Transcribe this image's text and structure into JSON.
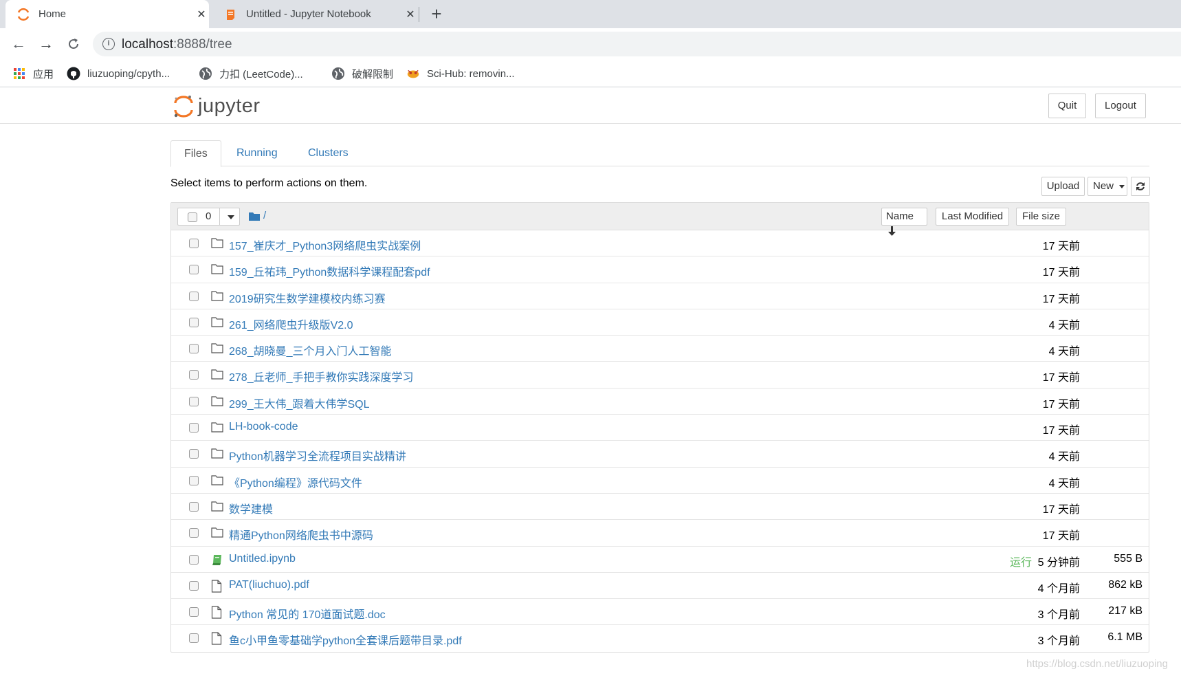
{
  "browser": {
    "tabs": [
      {
        "title": "Home",
        "active": true,
        "favicon": "jupyter-logo"
      },
      {
        "title": "Untitled - Jupyter Notebook",
        "active": false,
        "favicon": "notebook-icon"
      }
    ],
    "new_tab_symbol": "+",
    "address": {
      "host": "localhost",
      "rest": ":8888/tree"
    },
    "bookmarks": [
      {
        "label": "应用",
        "icon": "apps-grid-icon"
      },
      {
        "label": "liuzuoping/cpyth...",
        "icon": "github-icon"
      },
      {
        "label": "力扣 (LeetCode)...",
        "icon": "globe-icon"
      },
      {
        "label": "破解限制",
        "icon": "globe-icon"
      },
      {
        "label": "Sci-Hub: removin...",
        "icon": "scihub-icon"
      }
    ]
  },
  "header": {
    "logo_text": "jupyter",
    "quit_label": "Quit",
    "logout_label": "Logout"
  },
  "tabs": [
    {
      "label": "Files",
      "active": true
    },
    {
      "label": "Running",
      "active": false
    },
    {
      "label": "Clusters",
      "active": false
    }
  ],
  "hint_text": "Select items to perform actions on them.",
  "actions": {
    "upload_label": "Upload",
    "new_label": "New",
    "refresh_icon": "refresh-icon"
  },
  "list_header": {
    "selected_count": "0",
    "breadcrumb": "/",
    "sort_name_label": "Name",
    "sort_modified_label": "Last Modified",
    "sort_size_label": "File size"
  },
  "files": [
    {
      "type": "folder",
      "name": "157_崔庆才_Python3网络爬虫实战案例",
      "status": "",
      "modified": "17 天前",
      "size": ""
    },
    {
      "type": "folder",
      "name": "159_丘祐玮_Python数据科学课程配套pdf",
      "status": "",
      "modified": "17 天前",
      "size": ""
    },
    {
      "type": "folder",
      "name": "2019研究生数学建模校内练习赛",
      "status": "",
      "modified": "17 天前",
      "size": ""
    },
    {
      "type": "folder",
      "name": "261_网络爬虫升级版V2.0",
      "status": "",
      "modified": "4 天前",
      "size": ""
    },
    {
      "type": "folder",
      "name": "268_胡晓曼_三个月入门人工智能",
      "status": "",
      "modified": "4 天前",
      "size": ""
    },
    {
      "type": "folder",
      "name": "278_丘老师_手把手教你实践深度学习",
      "status": "",
      "modified": "17 天前",
      "size": ""
    },
    {
      "type": "folder",
      "name": "299_王大伟_跟着大伟学SQL",
      "status": "",
      "modified": "17 天前",
      "size": ""
    },
    {
      "type": "folder",
      "name": "LH-book-code",
      "status": "",
      "modified": "17 天前",
      "size": ""
    },
    {
      "type": "folder",
      "name": "Python机器学习全流程项目实战精讲",
      "status": "",
      "modified": "4 天前",
      "size": ""
    },
    {
      "type": "folder",
      "name": "《Python编程》源代码文件",
      "status": "",
      "modified": "4 天前",
      "size": ""
    },
    {
      "type": "folder",
      "name": "数学建模",
      "status": "",
      "modified": "17 天前",
      "size": ""
    },
    {
      "type": "folder",
      "name": "精通Python网络爬虫书中源码",
      "status": "",
      "modified": "17 天前",
      "size": ""
    },
    {
      "type": "notebook",
      "name": "Untitled.ipynb",
      "status": "运行",
      "modified": "5 分钟前",
      "size": "555 B"
    },
    {
      "type": "file",
      "name": "PAT(liuchuo).pdf",
      "status": "",
      "modified": "4 个月前",
      "size": "862 kB"
    },
    {
      "type": "file",
      "name": "Python 常见的 170道面试题.doc",
      "status": "",
      "modified": "3 个月前",
      "size": "217 kB"
    },
    {
      "type": "file",
      "name": "鱼c小甲鱼零基础学python全套课后题带目录.pdf",
      "status": "",
      "modified": "3 个月前",
      "size": "6.1 MB"
    }
  ],
  "watermark": "https://blog.csdn.net/liuzuoping"
}
